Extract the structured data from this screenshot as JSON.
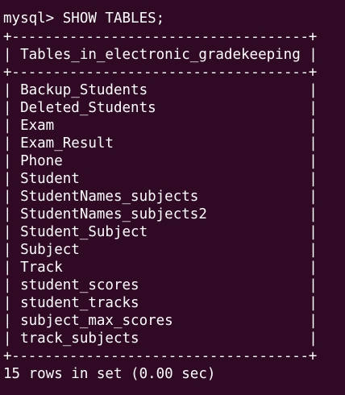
{
  "terminal": {
    "prompt": "mysql> SHOW TABLES;",
    "border": "+------------------------------------+",
    "header": "| Tables_in_electronic_gradekeeping |",
    "rows": [
      "| Backup_Students                   |",
      "| Deleted_Students                  |",
      "| Exam                              |",
      "| Exam_Result                       |",
      "| Phone                             |",
      "| Student                           |",
      "| StudentNames_subjects             |",
      "| StudentNames_subjects2            |",
      "| Student_Subject                   |",
      "| Subject                           |",
      "| Track                             |",
      "| student_scores                    |",
      "| student_tracks                    |",
      "| subject_max_scores                |",
      "| track_subjects                    |"
    ],
    "footer": "15 rows in set (0.00 sec)"
  },
  "colors": {
    "background": "#300a24",
    "text": "#ffffff"
  }
}
